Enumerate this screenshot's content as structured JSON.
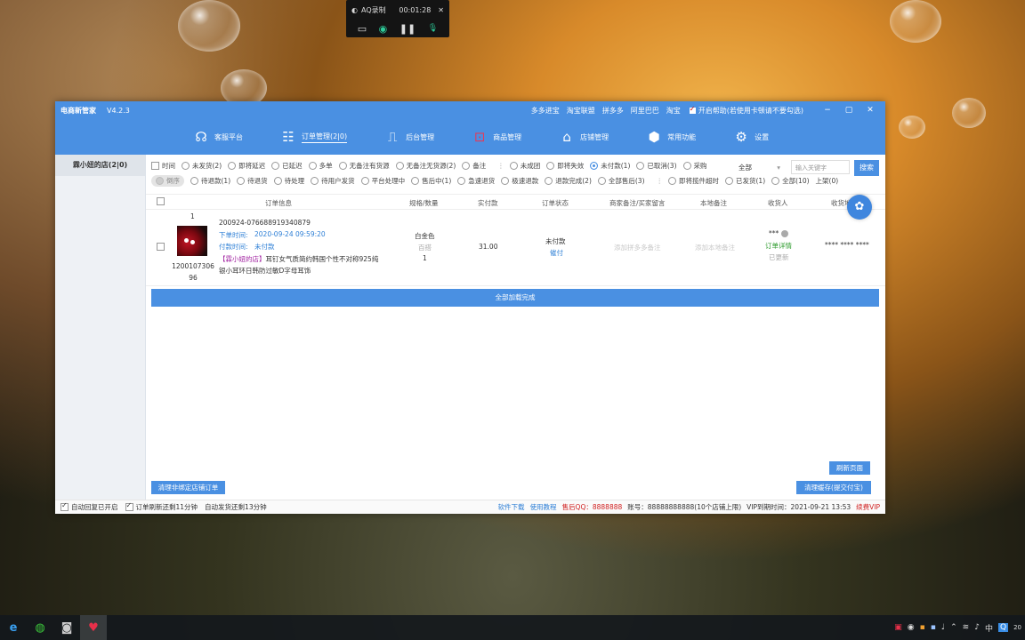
{
  "recorder": {
    "title": "AQ录制",
    "time": "00:01:28",
    "close": "✕",
    "controls": [
      "▭",
      "◉",
      "❚❚",
      "🎙"
    ]
  },
  "window": {
    "app_name": "电商新管家",
    "version": "V4.2.3",
    "platforms": [
      "多多进宝",
      "淘宝联盟",
      "拼多多",
      "阿里巴巴",
      "淘宝"
    ],
    "help_toggle_label": "开启帮助(若使用卡顿请不要勾选)",
    "controls": {
      "min": "−",
      "max": "▢",
      "close": "✕"
    }
  },
  "nav": [
    {
      "label": "客服平台",
      "icon": "headset-icon",
      "glyph": "☊"
    },
    {
      "label": "订单管理(2|0)",
      "icon": "clipboard-icon",
      "glyph": "☷",
      "active": true
    },
    {
      "label": "后台管理",
      "icon": "monitor-icon",
      "glyph": "⎍"
    },
    {
      "label": "商品管理",
      "icon": "goods-icon",
      "glyph": "⊡"
    },
    {
      "label": "店铺管理",
      "icon": "store-icon",
      "glyph": "⌂"
    },
    {
      "label": "常用功能",
      "icon": "cube-icon",
      "glyph": "⬢"
    },
    {
      "label": "设置",
      "icon": "gear-icon",
      "glyph": "⚙"
    }
  ],
  "sidebar": {
    "shops": [
      {
        "label": "霖小妞的店(2|0)"
      }
    ]
  },
  "filters": {
    "row1": [
      "时间",
      "未发货(2)",
      "即将延迟",
      "已延迟",
      "多单",
      "无备注有货源",
      "无备注无货源(2)",
      "备注",
      "未成团",
      "即将失效",
      "未付款(1)",
      "已取消(3)",
      "采购"
    ],
    "row1_selected": 10,
    "row2": [
      "倒序",
      "待退款(1)",
      "待退货",
      "待处理",
      "待用户发货",
      "平台处理中",
      "售后中(1)",
      "急速退货",
      "极速退款",
      "退款完成(2)",
      "全部售后(3)",
      "即将揽件超时",
      "已发货(1)",
      "全部(10)",
      "上架(0)"
    ],
    "status_select": "全部",
    "keyword_placeholder": "输入关键字",
    "search_label": "搜索"
  },
  "table": {
    "headers": [
      "订单信息",
      "规格/数量",
      "实付款",
      "订单状态",
      "商家备注/买家留言",
      "本地备注",
      "收货人",
      "收货地址"
    ],
    "rows": [
      {
        "index": "1",
        "goods_id": "120010730696",
        "order_no": "200924-076688919340879",
        "order_time_label": "下单时间:",
        "order_time": "2020-09-24 09:59:20",
        "pay_time_label": "付款时间:",
        "pay_time": "未付款",
        "shop_tag": "【霖小妞的店】",
        "title": "耳钉女气质简约韩国个性不对称925纯银小耳环日韩防过敏D字母耳饰",
        "spec_color": "白金色",
        "spec_type": "百搭",
        "qty": "1",
        "paid": "31.00",
        "status": "未付款",
        "status_action": "催付",
        "merchant_note": "添加拼多多备注",
        "local_note": "添加本地备注",
        "receiver": "*** ",
        "detail_link": "订单详情",
        "updated": "已更新",
        "address": "**** **** ****"
      }
    ]
  },
  "progress_label": "全部加载完成",
  "buttons": {
    "clear_unbound": "清理非绑定店铺订单",
    "refresh": "刷新页面",
    "clear_cache": "清理缓存(提交付宝)"
  },
  "statusbar": {
    "auto_reply": "自动回复已开启",
    "order_refresh": "订单刷新还剩11分钟",
    "auto_ship": "自动发货还剩13分钟",
    "download": "软件下载",
    "tutorial": "使用教程",
    "aftersale_qq": "售后QQ：8888888",
    "account": "账号：88888888888(10个店铺上限)",
    "vip_expiry": "VIP到期时间：2021-09-21 13:53",
    "renew": "续费VIP"
  },
  "taskbar": {
    "apps": [
      "e",
      "◍",
      "◙",
      "♥"
    ],
    "tray": [
      "中",
      "20"
    ]
  }
}
